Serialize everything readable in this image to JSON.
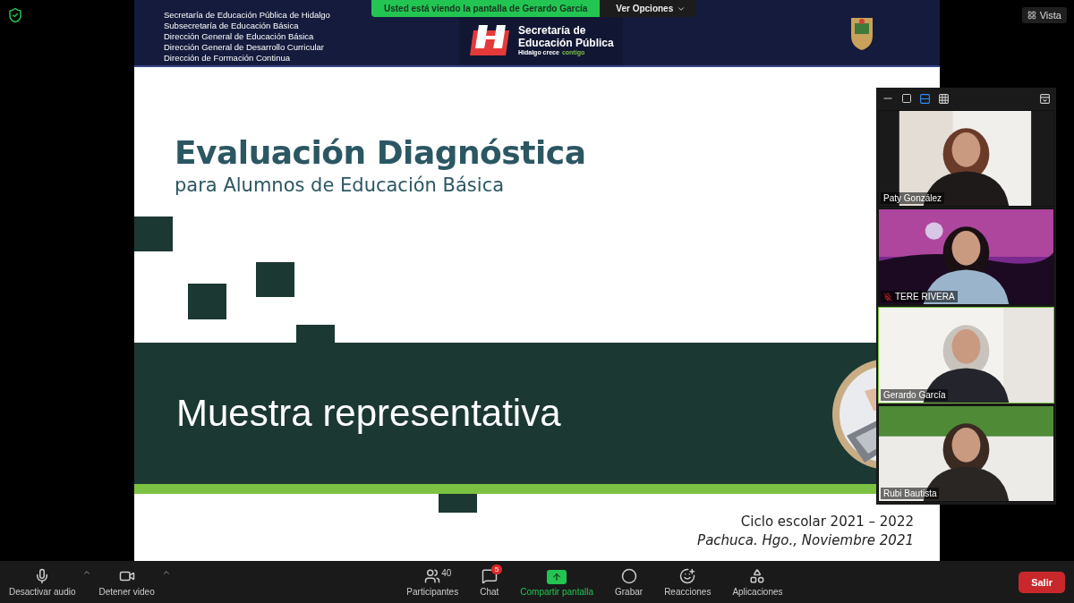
{
  "share_banner": {
    "text": "Usted está viendo la pantalla de Gerardo García",
    "options_button": "Ver Opciones"
  },
  "view_button": {
    "label": "Vista"
  },
  "slide": {
    "header_lines": [
      "Secretaría de Educación Pública de Hidalgo",
      "Subsecretaría de Educación Básica",
      "Dirección General de Educación Básica",
      "Dirección General de Desarrollo Curricular",
      "Dirección de Formación Continua"
    ],
    "logo": {
      "title_lines": [
        "Secretaría de",
        "Educación Pública"
      ],
      "slogan": "Hidalgo crece",
      "slogan_accent": "contigo"
    },
    "title": "Evaluación Diagnóstica",
    "subtitle": "para Alumnos de Educación Básica",
    "band_text": "Muestra representativa",
    "footer": [
      {
        "text": "Ciclo escolar 2021 – 2022",
        "italic": false
      },
      {
        "text": "Pachuca. Hgo.,  Noviembre 2021",
        "italic": true
      }
    ]
  },
  "gallery": {
    "participants": [
      {
        "name": "Paty González",
        "muted": false,
        "speaking": false,
        "kind": "picture"
      },
      {
        "name": "TERE RIVERA",
        "muted": true,
        "speaking": false,
        "kind": "picture"
      },
      {
        "name": "Gerardo García",
        "muted": false,
        "speaking": true,
        "kind": "picture"
      },
      {
        "name": "Rubi Bautista",
        "muted": false,
        "speaking": false,
        "kind": "picture"
      }
    ]
  },
  "toolbar": {
    "left": [
      {
        "label": "Desactivar audio"
      },
      {
        "label": "Detener video"
      }
    ],
    "center": [
      {
        "label": "Participantes",
        "count": "40",
        "highlighted": false
      },
      {
        "label": "Chat",
        "badge": "5",
        "highlighted": false
      },
      {
        "label": "Compartir pantalla",
        "highlighted": true
      },
      {
        "label": "Grabar",
        "highlighted": false
      },
      {
        "label": "Reacciones",
        "highlighted": false
      },
      {
        "label": "Aplicaciones",
        "highlighted": false
      }
    ],
    "leave_button": "Salir"
  }
}
